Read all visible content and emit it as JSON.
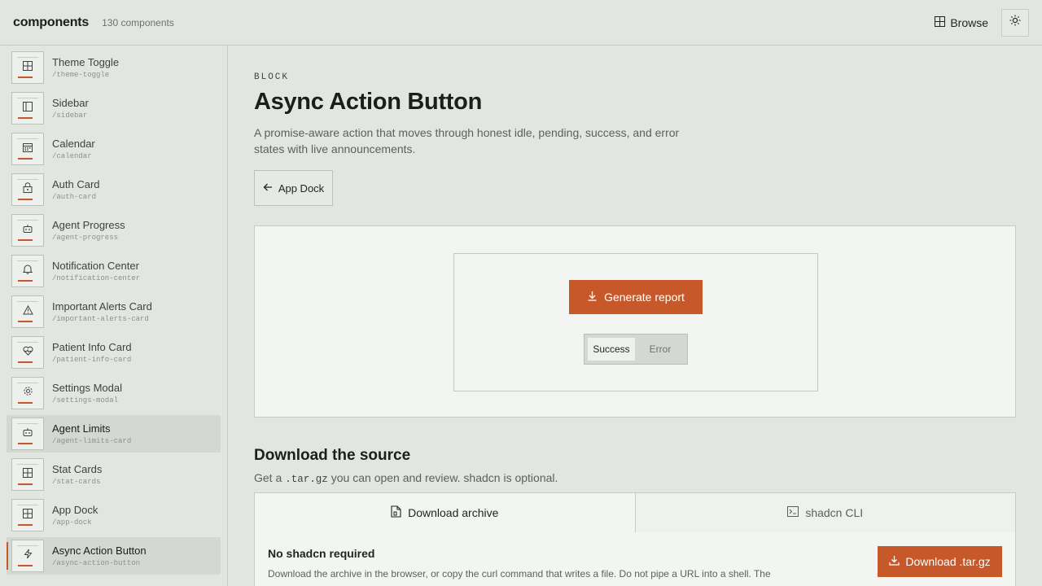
{
  "header": {
    "brand": "components",
    "count": "130 components",
    "browse_label": "Browse"
  },
  "sidebar": {
    "items": [
      {
        "title": "Theme Toggle",
        "slug": "/theme-toggle",
        "icon": "grid-icon"
      },
      {
        "title": "Sidebar",
        "slug": "/sidebar",
        "icon": "panel-left-icon"
      },
      {
        "title": "Calendar",
        "slug": "/calendar",
        "icon": "calendar-icon"
      },
      {
        "title": "Auth Card",
        "slug": "/auth-card",
        "icon": "lock-icon"
      },
      {
        "title": "Agent Progress",
        "slug": "/agent-progress",
        "icon": "bot-icon"
      },
      {
        "title": "Notification Center",
        "slug": "/notification-center",
        "icon": "bell-icon"
      },
      {
        "title": "Important Alerts Card",
        "slug": "/important-alerts-card",
        "icon": "alert-triangle-icon"
      },
      {
        "title": "Patient Info Card",
        "slug": "/patient-info-card",
        "icon": "heart-pulse-icon"
      },
      {
        "title": "Settings Modal",
        "slug": "/settings-modal",
        "icon": "gear-icon"
      },
      {
        "title": "Agent Limits",
        "slug": "/agent-limits-card",
        "icon": "bot-icon"
      },
      {
        "title": "Stat Cards",
        "slug": "/stat-cards",
        "icon": "grid-icon"
      },
      {
        "title": "App Dock",
        "slug": "/app-dock",
        "icon": "grid-icon"
      },
      {
        "title": "Async Action Button",
        "slug": "/async-action-button",
        "icon": "zap-icon"
      }
    ]
  },
  "main": {
    "eyebrow": "BLOCK",
    "title": "Async Action Button",
    "description": "A promise-aware action that moves through honest idle, pending, success, and error states with live announcements.",
    "back_label": "App Dock",
    "preview": {
      "action_label": "Generate report",
      "segments": [
        "Success",
        "Error"
      ],
      "selected_segment": "Success"
    },
    "download": {
      "title": "Download the source",
      "subtitle_prefix": "Get a",
      "subtitle_code": ".tar.gz",
      "subtitle_suffix": "you can open and review. shadcn is optional.",
      "tabs": [
        "Download archive",
        "shadcn CLI"
      ],
      "panel_title": "No shadcn required",
      "panel_text": "Download the archive in the browser, or copy the curl command that writes a file. Do not pipe a URL into a shell. The",
      "button_label": "Download .tar.gz"
    }
  },
  "colors": {
    "accent": "#c6582a",
    "background": "#e2e6e1",
    "surface": "#f3f5f2"
  }
}
